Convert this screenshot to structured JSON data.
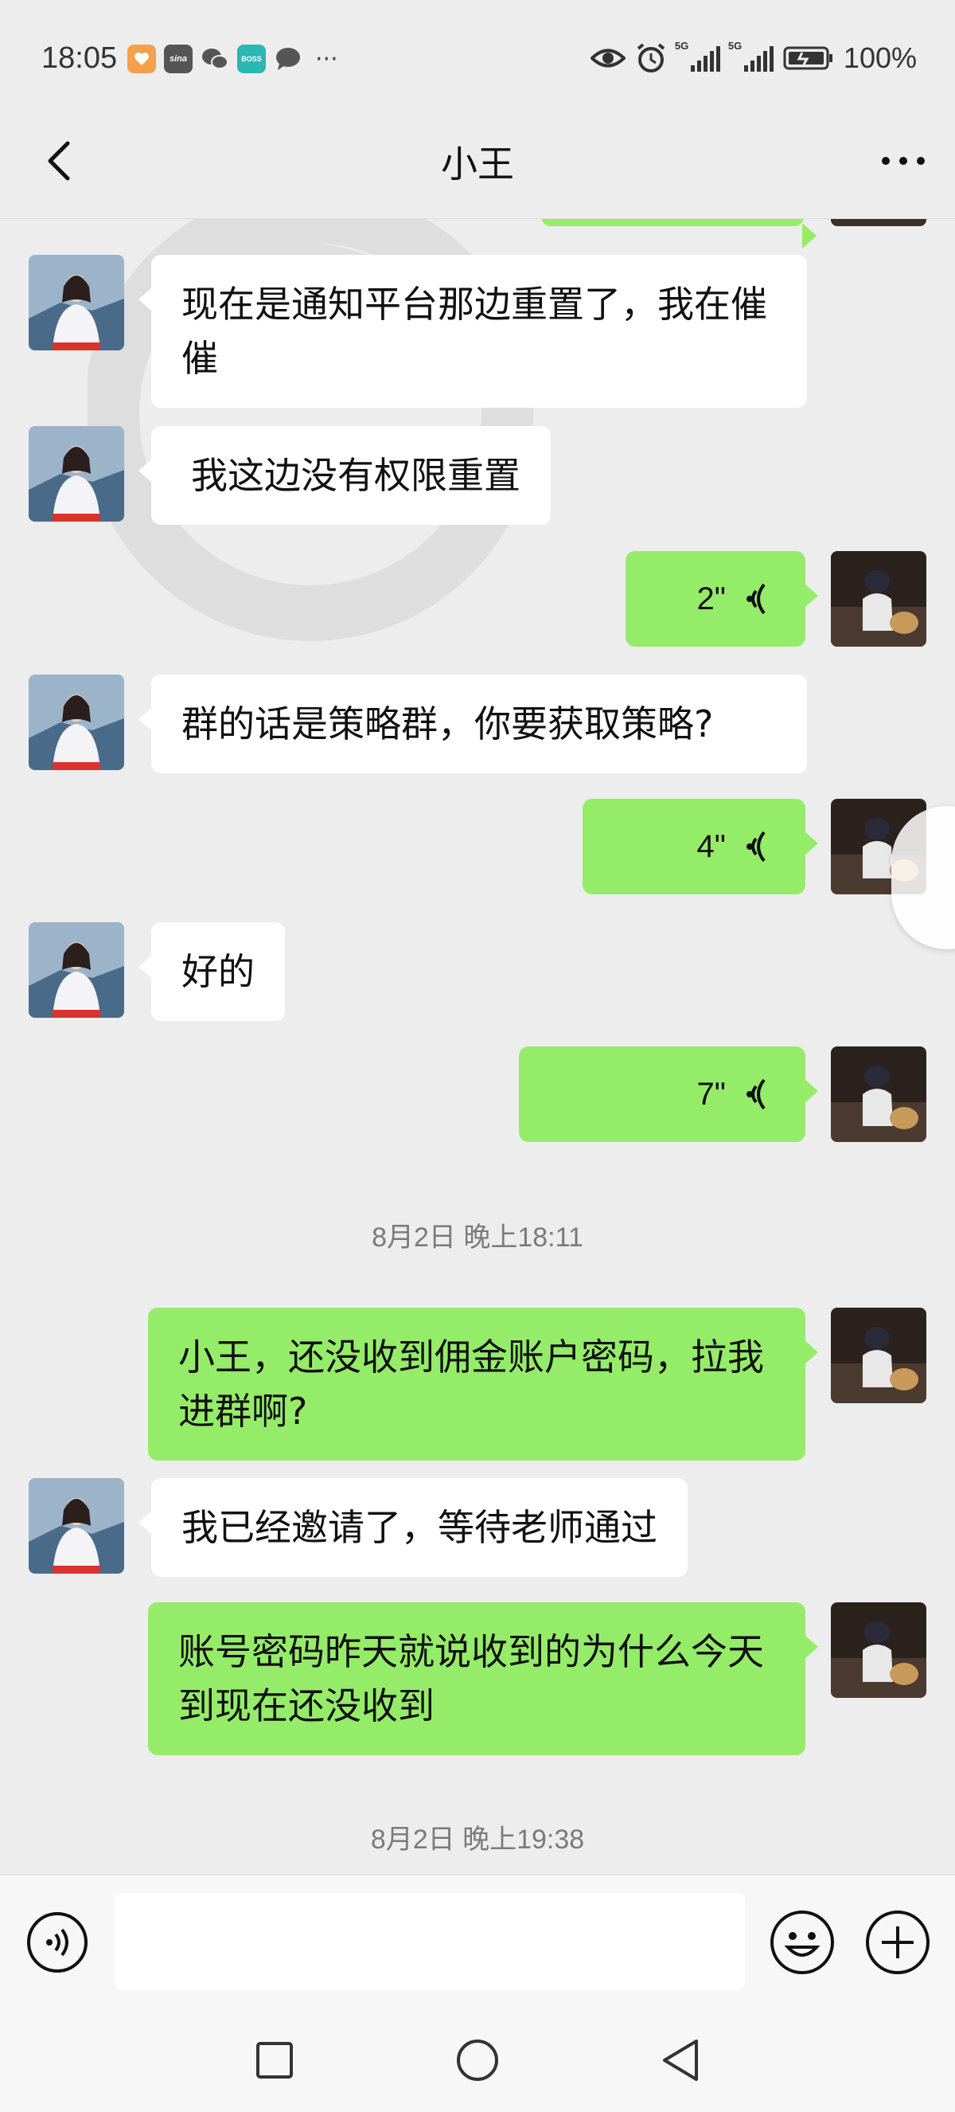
{
  "status_bar": {
    "time": "18:05",
    "battery": "100%",
    "apps": [
      {
        "icon": "heart-app-icon",
        "text": "",
        "color": "#f5a04a"
      },
      {
        "icon": "sina-app-icon",
        "text": "sina",
        "color": "#555555"
      },
      {
        "icon": "wechat-app-icon",
        "text": "",
        "color": "#555555"
      },
      {
        "icon": "boss-app-icon",
        "text": "BOSS",
        "color": "#2bb7b3"
      },
      {
        "icon": "message-app-icon",
        "text": "",
        "color": "#555555"
      }
    ],
    "more_dots": "···",
    "network_label_1": "5G",
    "network_label_2": "5G"
  },
  "header": {
    "title": "小王"
  },
  "messages": [
    {
      "dir": "in",
      "text": "现在是通知平台那边重置了，我在催催"
    },
    {
      "dir": "in",
      "text": "我这边没有权限重置"
    },
    {
      "dir": "out",
      "type": "voice",
      "duration": "2\""
    },
    {
      "dir": "in",
      "text": "群的话是策略群，你要获取策略?"
    },
    {
      "dir": "out",
      "type": "voice",
      "duration": "4\""
    },
    {
      "dir": "in",
      "text": "好的"
    },
    {
      "dir": "out",
      "type": "voice",
      "duration": "7\""
    },
    {
      "type": "timestamp",
      "text": "8月2日 晚上18:11"
    },
    {
      "dir": "out",
      "text": "小王，还没收到佣金账户密码，拉我进群啊?"
    },
    {
      "dir": "in",
      "text": "我已经邀请了，等待老师通过"
    },
    {
      "dir": "out",
      "text": "账号密码昨天就说收到的为什么今天到现在还没收到"
    },
    {
      "type": "timestamp",
      "text": "8月2日 晚上19:38"
    }
  ],
  "input": {
    "value": "",
    "placeholder": ""
  },
  "colors": {
    "incoming_bubble": "#ffffff",
    "outgoing_bubble": "#95ec69",
    "background": "#ededed"
  }
}
